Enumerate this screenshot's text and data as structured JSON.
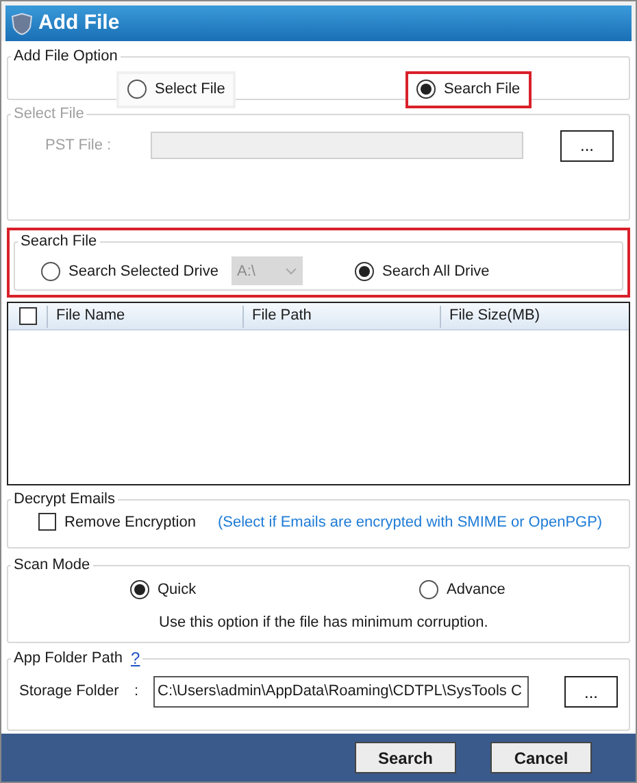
{
  "window": {
    "title": "Add File"
  },
  "add_file_option": {
    "title": "Add File Option",
    "options": [
      {
        "label": "Select File",
        "selected": false,
        "highlighted": false
      },
      {
        "label": "Search File",
        "selected": true,
        "highlighted": true
      }
    ]
  },
  "select_file": {
    "title": "Select File",
    "disabled": true,
    "label": "PST File :",
    "browse": "..."
  },
  "search_file": {
    "title": "Search File",
    "highlighted": true,
    "options": [
      {
        "label": "Search Selected Drive",
        "selected": false
      },
      {
        "label": "Search All Drive",
        "selected": true
      }
    ],
    "drive": {
      "value": "A:\\",
      "disabled": true
    }
  },
  "table": {
    "select_all_checked": false,
    "columns": [
      "File Name",
      "File Path",
      "File Size(MB)"
    ]
  },
  "decrypt": {
    "title": "Decrypt Emails",
    "checkbox": {
      "label": "Remove Encryption",
      "checked": false
    },
    "hint": "(Select if Emails are encrypted with SMIME or OpenPGP)"
  },
  "scan_mode": {
    "title": "Scan Mode",
    "options": [
      {
        "label": "Quick",
        "selected": true
      },
      {
        "label": "Advance",
        "selected": false
      }
    ],
    "description": "Use this option if the file has minimum corruption."
  },
  "app_folder": {
    "title": "App Folder Path",
    "help": "?",
    "label": "Storage Folder",
    "separator": ":",
    "value": "C:\\Users\\admin\\AppData\\Roaming\\CDTPL\\SysTools C",
    "browse": "..."
  },
  "buttons": [
    "Search",
    "Cancel"
  ]
}
